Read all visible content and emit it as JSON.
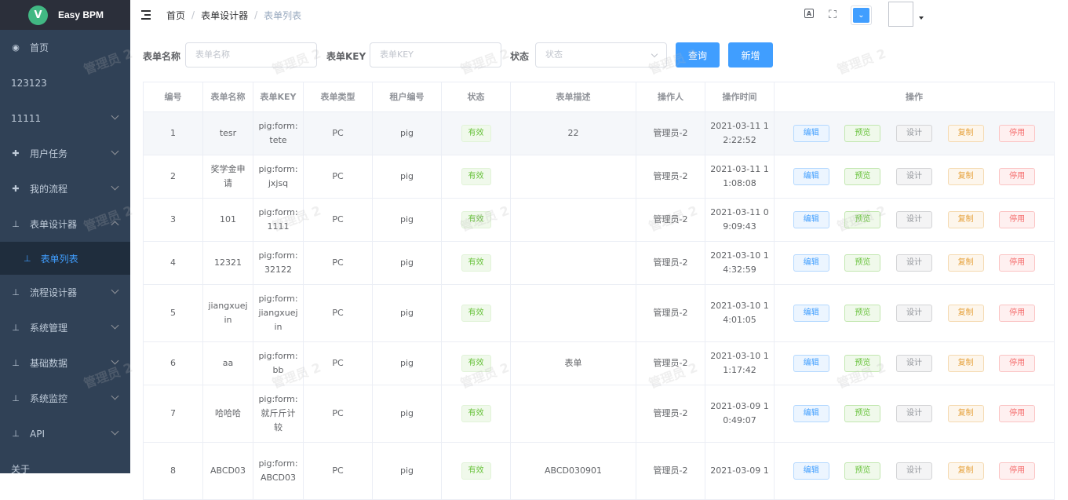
{
  "app": {
    "logo_letter": "V",
    "title": "Easy BPM"
  },
  "sidebar": {
    "items": [
      {
        "label": "首页",
        "icon": "dashboard-icon",
        "chevron": ""
      },
      {
        "label": "123123",
        "icon": "",
        "chevron": ""
      },
      {
        "label": "11111",
        "icon": "",
        "chevron": "down"
      },
      {
        "label": "用户任务",
        "icon": "task-icon",
        "chevron": "down"
      },
      {
        "label": "我的流程",
        "icon": "process-icon",
        "chevron": "down"
      },
      {
        "label": "表单设计器",
        "icon": "tree-icon",
        "chevron": "up"
      },
      {
        "label": "流程设计器",
        "icon": "tree-icon",
        "chevron": "down"
      },
      {
        "label": "系统管理",
        "icon": "tree-icon",
        "chevron": "down"
      },
      {
        "label": "基础数据",
        "icon": "tree-icon",
        "chevron": "down"
      },
      {
        "label": "系统监控",
        "icon": "tree-icon",
        "chevron": "down"
      },
      {
        "label": "API",
        "icon": "tree-icon",
        "chevron": "down"
      },
      {
        "label": "关于",
        "icon": "",
        "chevron": ""
      }
    ],
    "active_sub": "表单列表"
  },
  "breadcrumb": [
    "首页",
    "表单设计器",
    "表单列表"
  ],
  "watermark": "管理员 2",
  "search": {
    "name_label": "表单名称",
    "name_placeholder": "表单名称",
    "key_label": "表单KEY",
    "key_placeholder": "表单KEY",
    "status_label": "状态",
    "status_placeholder": "状态",
    "query_button": "查询",
    "add_button": "新增"
  },
  "table": {
    "headers": [
      "编号",
      "表单名称",
      "表单KEY",
      "表单类型",
      "租户编号",
      "状态",
      "表单描述",
      "操作人",
      "操作时间",
      "操作"
    ],
    "op_labels": {
      "edit": "编辑",
      "preview": "预览",
      "design": "设计",
      "copy": "复制",
      "stop": "停用"
    },
    "rows": [
      {
        "id": "1",
        "name": "tesr",
        "key": "pig:form:tete",
        "type": "PC",
        "tenant": "pig",
        "status": "有效",
        "desc": "22",
        "operator": "管理员-2",
        "time": "2021-03-11 12:22:52"
      },
      {
        "id": "2",
        "name": "奖学金申请",
        "key": "pig:form:jxjsq",
        "type": "PC",
        "tenant": "pig",
        "status": "有效",
        "desc": "",
        "operator": "管理员-2",
        "time": "2021-03-11 11:08:08"
      },
      {
        "id": "3",
        "name": "101",
        "key": "pig:form:1111",
        "type": "PC",
        "tenant": "pig",
        "status": "有效",
        "desc": "",
        "operator": "管理员-2",
        "time": "2021-03-11 09:09:43"
      },
      {
        "id": "4",
        "name": "12321",
        "key": "pig:form:32122",
        "type": "PC",
        "tenant": "pig",
        "status": "有效",
        "desc": "",
        "operator": "管理员-2",
        "time": "2021-03-10 14:32:59"
      },
      {
        "id": "5",
        "name": "jiangxuejin",
        "key": "pig:form:jiangxuejin",
        "type": "PC",
        "tenant": "pig",
        "status": "有效",
        "desc": "",
        "operator": "管理员-2",
        "time": "2021-03-10 14:01:05"
      },
      {
        "id": "6",
        "name": "aa",
        "key": "pig:form:bb",
        "type": "PC",
        "tenant": "pig",
        "status": "有效",
        "desc": "表单",
        "operator": "管理员-2",
        "time": "2021-03-10 11:17:42"
      },
      {
        "id": "7",
        "name": "哈哈哈",
        "key": "pig:form:就斤斤计较",
        "type": "PC",
        "tenant": "pig",
        "status": "有效",
        "desc": "",
        "operator": "管理员-2",
        "time": "2021-03-09 10:49:07"
      },
      {
        "id": "8",
        "name": "ABCD03",
        "key": "pig:form:ABCD03",
        "type": "PC",
        "tenant": "pig",
        "status": "有效",
        "desc": "ABCD030901",
        "operator": "管理员-2",
        "time": "2021-03-09 1"
      }
    ]
  }
}
